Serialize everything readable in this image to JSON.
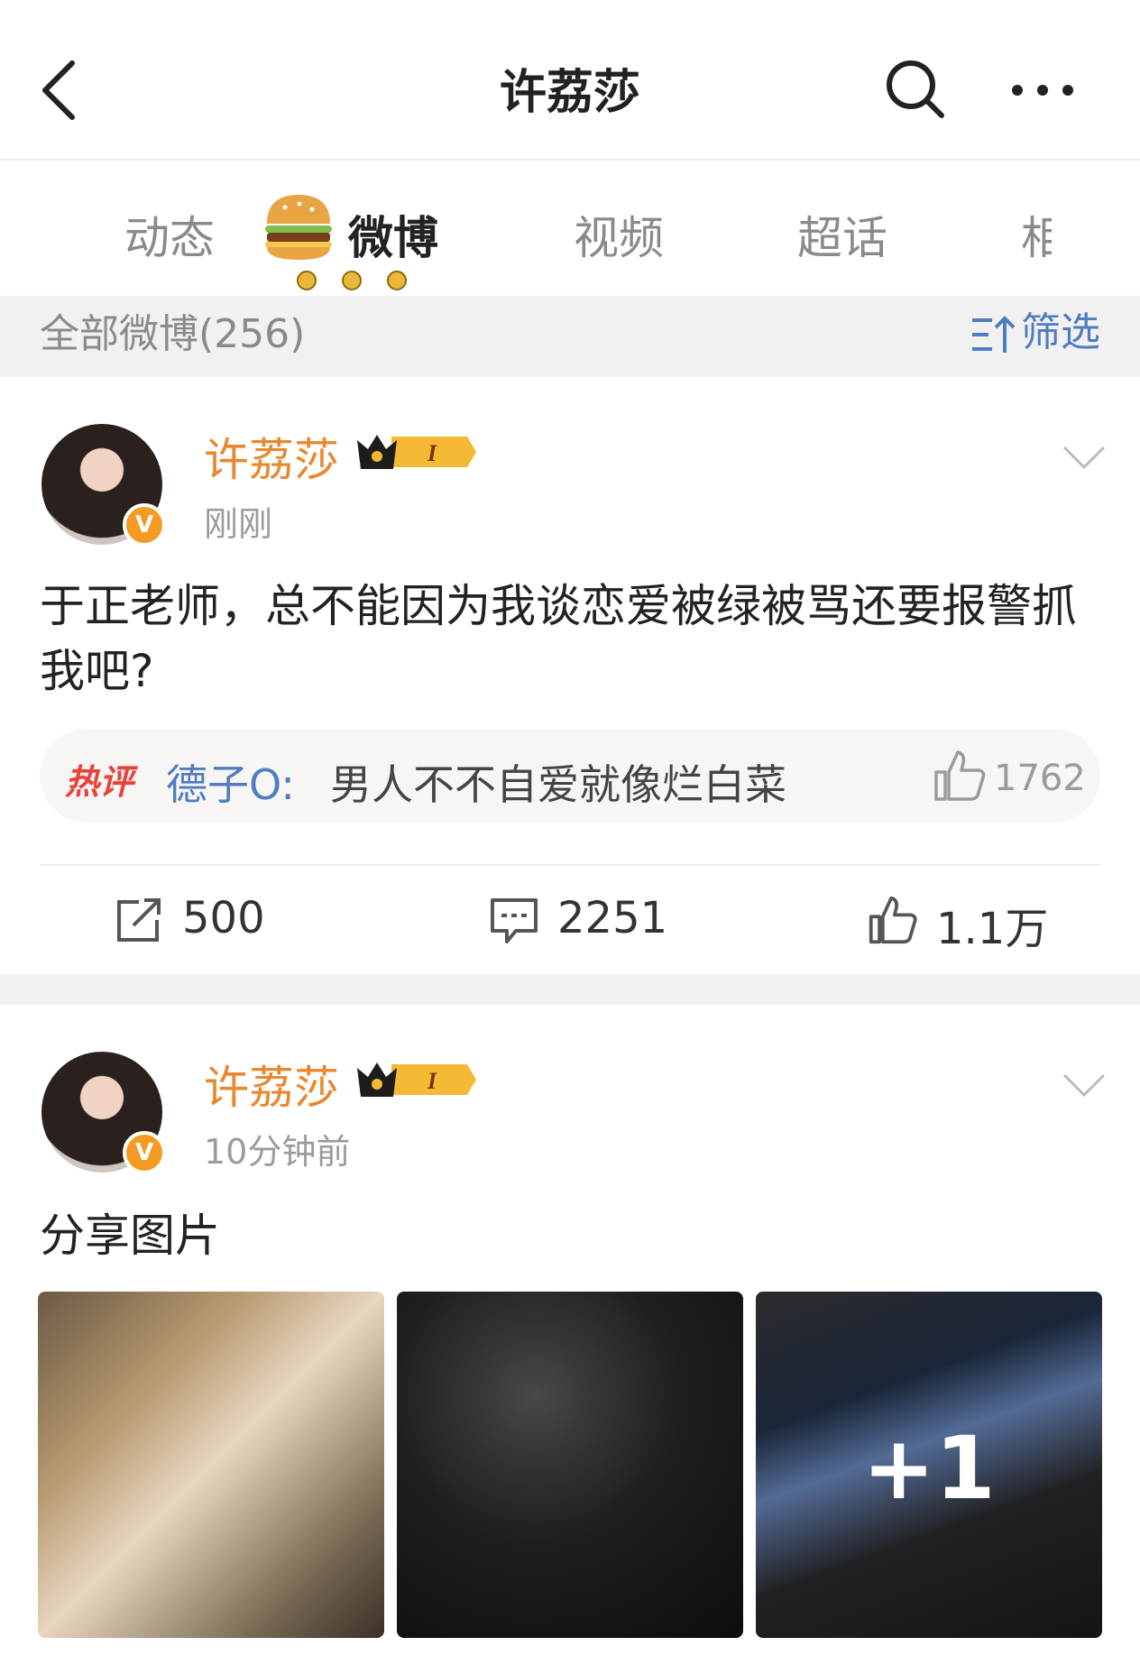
{
  "header": {
    "title": "许荔莎"
  },
  "tabs": [
    {
      "label": "动态"
    },
    {
      "label": "微博"
    },
    {
      "label": "视频"
    },
    {
      "label": "超话"
    },
    {
      "label": "相"
    }
  ],
  "filter": {
    "count_label": "全部微博(256)",
    "filter_label": "筛选"
  },
  "posts": [
    {
      "user": "许荔莎",
      "time": "刚刚",
      "text": "于正老师，总不能因为我谈恋爱被绿被骂还要报警抓我吧?",
      "hot_comment": {
        "tag": "热评",
        "user": "德子O",
        "text": "男人不不自爱就像烂白菜",
        "likes": "1762"
      },
      "actions": {
        "reposts": "500",
        "comments": "2251",
        "likes": "1.1万"
      }
    },
    {
      "user": "许荔莎",
      "time": "10分钟前",
      "text": "分享图片",
      "extra_photos": "+1"
    }
  ],
  "badge": {
    "verified_symbol": "V",
    "level": "I"
  },
  "colors": {
    "username": "#e8882f",
    "link": "#4f7dc2",
    "hot": "#e8423a"
  }
}
